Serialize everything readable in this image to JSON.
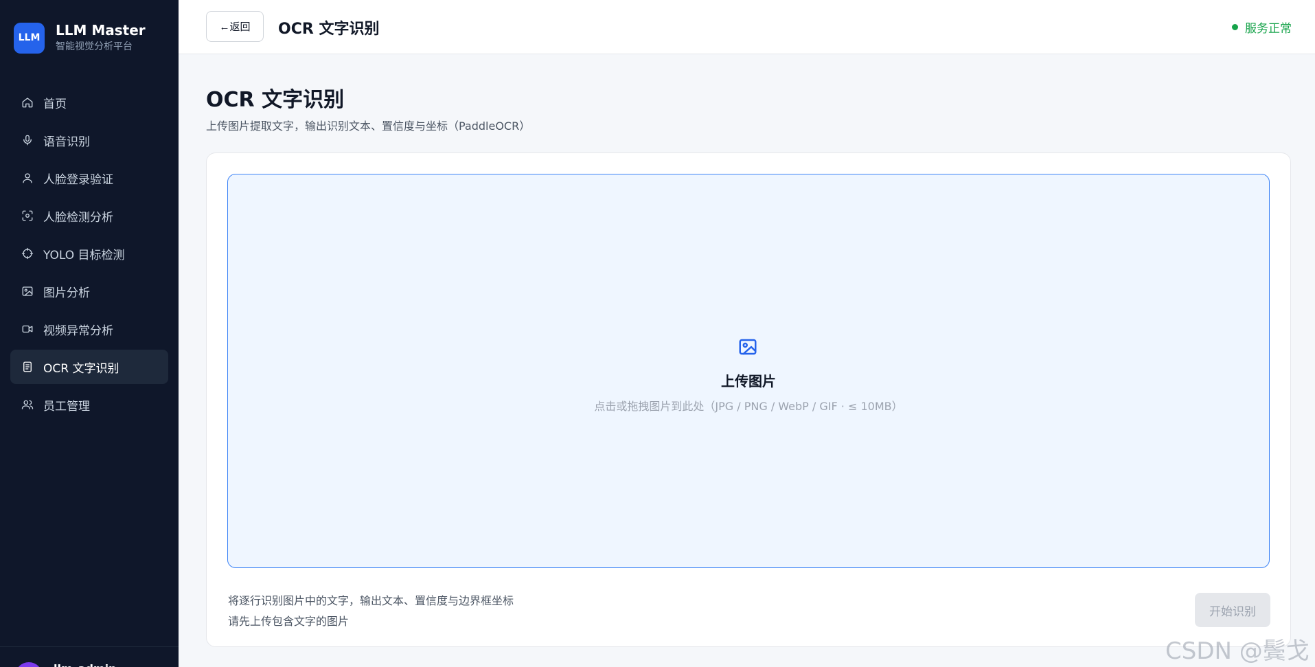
{
  "brand": {
    "logo": "LLM",
    "name": "LLM Master",
    "subtitle": "智能视觉分析平台"
  },
  "sidebar": {
    "items": [
      {
        "label": "首页",
        "icon": "home-icon"
      },
      {
        "label": "语音识别",
        "icon": "microphone-icon"
      },
      {
        "label": "人脸登录验证",
        "icon": "user-icon"
      },
      {
        "label": "人脸检测分析",
        "icon": "face-scan-icon"
      },
      {
        "label": "YOLO 目标检测",
        "icon": "crosshair-icon"
      },
      {
        "label": "图片分析",
        "icon": "image-icon"
      },
      {
        "label": "视频异常分析",
        "icon": "video-icon"
      },
      {
        "label": "OCR 文字识别",
        "icon": "document-icon",
        "active": true
      },
      {
        "label": "员工管理",
        "icon": "users-icon"
      }
    ],
    "footer": {
      "user_name": "llm_admin"
    }
  },
  "topbar": {
    "back_label": "←返回",
    "title": "OCR 文字识别",
    "status": "服务正常"
  },
  "main": {
    "title": "OCR 文字识别",
    "subtitle": "上传图片提取文字，输出识别文本、置信度与坐标（PaddleOCR）",
    "upload": {
      "title": "上传图片",
      "hint": "点击或拖拽图片到此处（JPG / PNG / WebP / GIF · ≤ 10MB）"
    },
    "info_line1": "将逐行识别图片中的文字，输出文本、置信度与边界框坐标",
    "info_line2": "请先上传包含文字的图片",
    "start_button": "开始识别"
  },
  "watermark": "CSDN @鬓戈",
  "colors": {
    "sidebar_bg": "#0f172a",
    "accent": "#2563eb",
    "status_ok": "#16a34a"
  }
}
